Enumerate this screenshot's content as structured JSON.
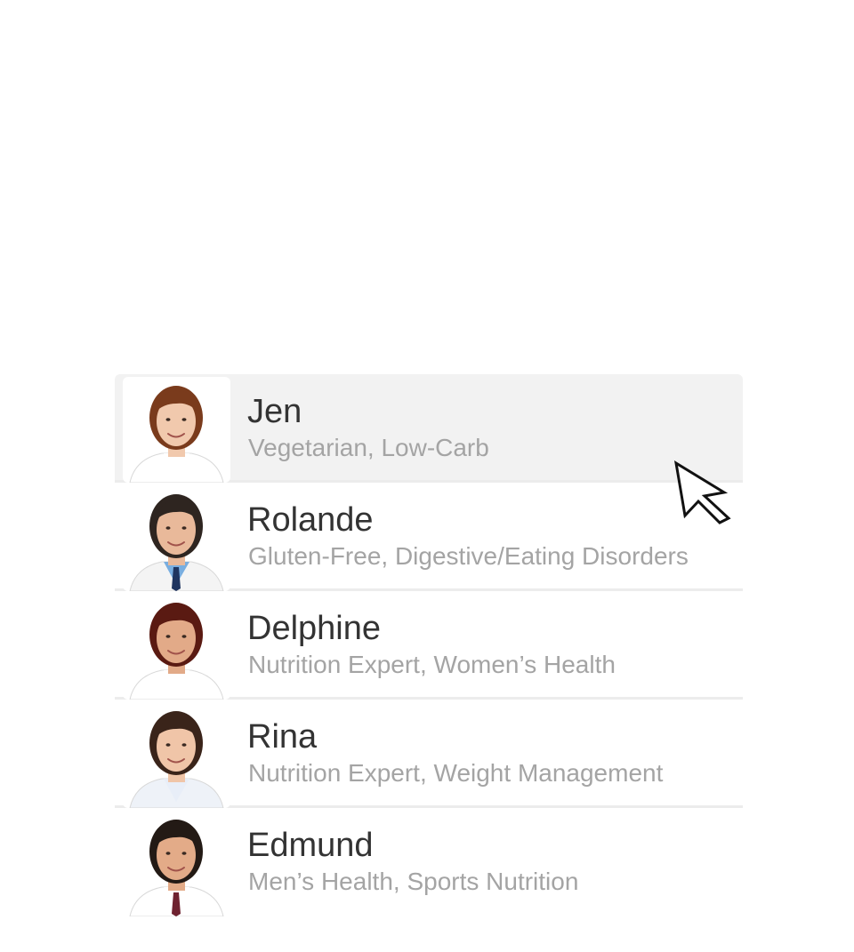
{
  "experts": [
    {
      "name": "Jen",
      "specialty": "Vegetarian, Low-Carb",
      "selected": true,
      "hair_color": "#7a3b1c",
      "skin_color": "#f1c9ad",
      "coat_color": "#ffffff",
      "shirt_color": "#ffffff",
      "tie_color": ""
    },
    {
      "name": "Rolande",
      "specialty": "Gluten-Free, Digestive/Eating Disorders",
      "selected": false,
      "hair_color": "#2e2520",
      "skin_color": "#e9b99a",
      "coat_color": "#f4f4f4",
      "shirt_color": "#79aee0",
      "tie_color": "#1f3560"
    },
    {
      "name": "Delphine",
      "specialty": "Nutrition Expert, Women’s Health",
      "selected": false,
      "hair_color": "#5a1a12",
      "skin_color": "#e2aa88",
      "coat_color": "#ffffff",
      "shirt_color": "#ffffff",
      "tie_color": ""
    },
    {
      "name": "Rina",
      "specialty": "Nutrition Expert, Weight Management",
      "selected": false,
      "hair_color": "#3a241a",
      "skin_color": "#f0c5a8",
      "coat_color": "#eef2f8",
      "shirt_color": "#e8eef8",
      "tie_color": ""
    },
    {
      "name": "Edmund",
      "specialty": "Men’s Health, Sports Nutrition",
      "selected": false,
      "hair_color": "#231a15",
      "skin_color": "#e3ab88",
      "coat_color": "#ffffff",
      "shirt_color": "#ffffff",
      "tie_color": "#6e2230"
    }
  ]
}
